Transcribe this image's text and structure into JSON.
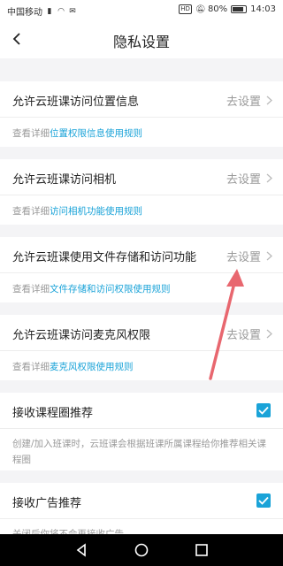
{
  "status_bar": {
    "carrier": "中国移动",
    "battery_percent": "80%",
    "time": "14:03",
    "hd_badge": "HD"
  },
  "nav": {
    "title": "隐私设置"
  },
  "permissions": [
    {
      "label": "允许云班课访问位置信息",
      "action": "去设置",
      "sub_prefix": "查看详细",
      "sub_link": "位置权限信息使用规则"
    },
    {
      "label": "允许云班课访问相机",
      "action": "去设置",
      "sub_prefix": "查看详细",
      "sub_link": "访问相机功能使用规则"
    },
    {
      "label": "允许云班课使用文件存储和访问功能",
      "action": "去设置",
      "sub_prefix": "查看详细",
      "sub_link": "文件存储和访问权限使用规则"
    },
    {
      "label": "允许云班课访问麦克风权限",
      "action": "去设置",
      "sub_prefix": "查看详细",
      "sub_link": "麦克风权限使用规则"
    }
  ],
  "toggles": [
    {
      "label": "接收课程圈推荐",
      "checked": true,
      "description": "创建/加入班课时，云班课会根据班课所属课程给你推荐相关课程圈"
    },
    {
      "label": "接收广告推荐",
      "checked": true,
      "description": "关闭后你将不会再接收广告"
    }
  ],
  "colors": {
    "accent": "#1aa3d8",
    "annotation_arrow": "#e8676f"
  }
}
